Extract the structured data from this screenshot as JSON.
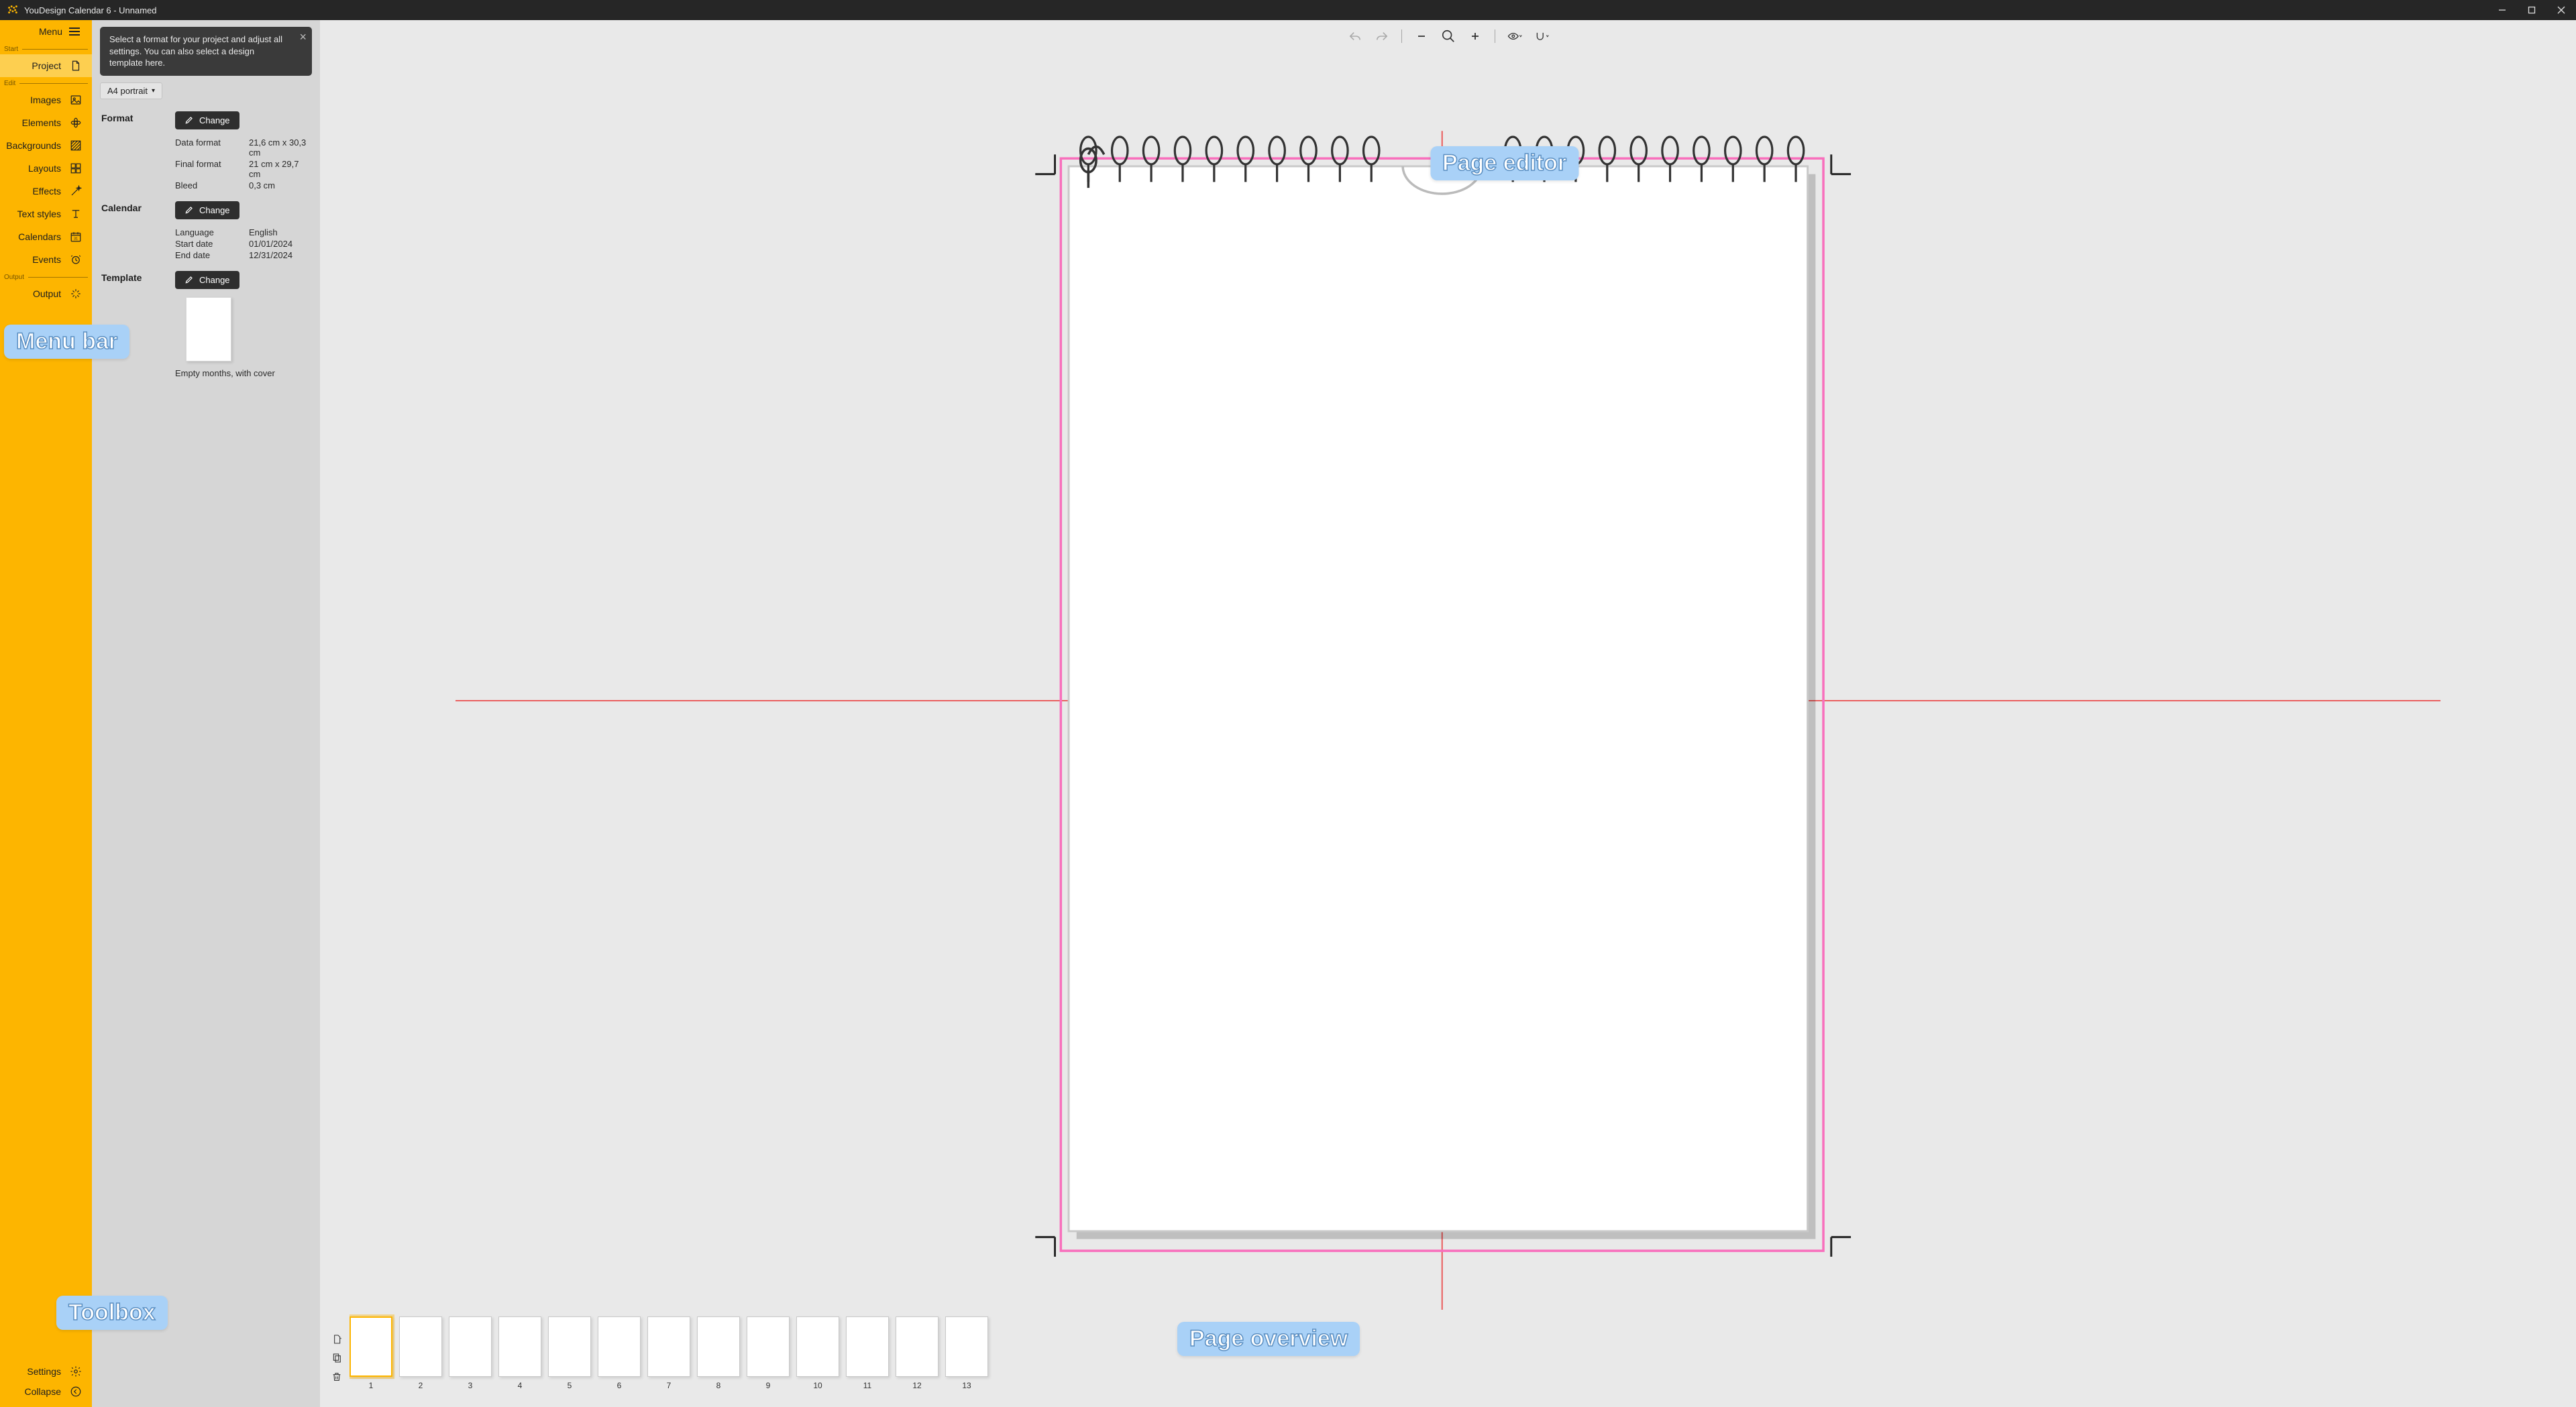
{
  "window": {
    "title": "YouDesign Calendar 6 - Unnamed"
  },
  "sidebar": {
    "menu_label": "Menu",
    "sections": {
      "start": "Start",
      "edit": "Edit",
      "output": "Output"
    },
    "items": {
      "project": "Project",
      "images": "Images",
      "elements": "Elements",
      "backgrounds": "Backgrounds",
      "layouts": "Layouts",
      "effects": "Effects",
      "text_styles": "Text styles",
      "calendars": "Calendars",
      "events": "Events",
      "output": "Output",
      "settings": "Settings",
      "collapse": "Collapse"
    }
  },
  "toolbox": {
    "info": "Select a format for your project and adjust all settings. You can also select a design template here.",
    "format_picker": "A4 portrait",
    "format": {
      "title": "Format",
      "change": "Change",
      "data_format_label": "Data format",
      "data_format_value": "21,6 cm x 30,3 cm",
      "final_format_label": "Final format",
      "final_format_value": "21 cm x 29,7 cm",
      "bleed_label": "Bleed",
      "bleed_value": "0,3 cm"
    },
    "calendar": {
      "title": "Calendar",
      "change": "Change",
      "language_label": "Language",
      "language_value": "English",
      "start_label": "Start date",
      "start_value": "01/01/2024",
      "end_label": "End date",
      "end_value": "12/31/2024"
    },
    "template": {
      "title": "Template",
      "change": "Change",
      "name": "Empty months, with cover"
    }
  },
  "annotations": {
    "menu_bar": "Menu  bar",
    "toolbox": "Toolbox",
    "page_editor": "Page  editor",
    "page_overview": "Page  overview"
  },
  "page_overview": {
    "thumbs": [
      1,
      2,
      3,
      4,
      5,
      6,
      7,
      8,
      9,
      10,
      11,
      12,
      13
    ],
    "selected": 1
  }
}
